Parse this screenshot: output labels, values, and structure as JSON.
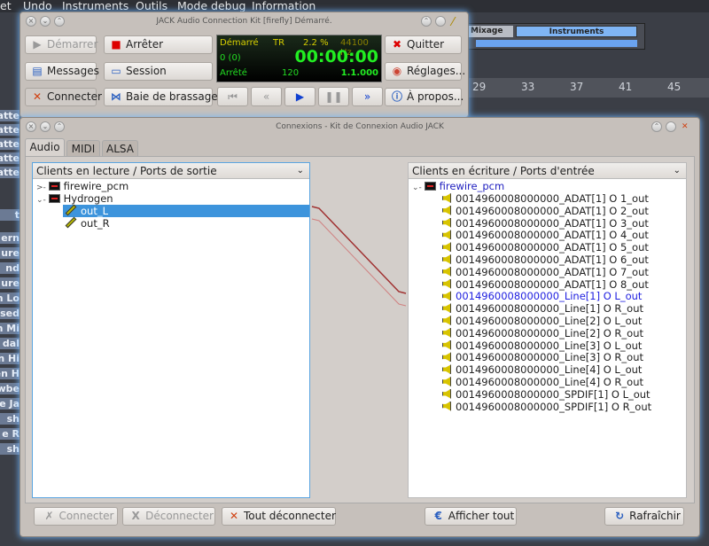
{
  "menubar": [
    "et",
    "Undo",
    "Instruments",
    "Outils",
    "Mode debug",
    "Information"
  ],
  "background": {
    "tabs": {
      "mixer": "Mixage",
      "instruments": "Instruments"
    },
    "ruler": [
      "29",
      "33",
      "37",
      "41",
      "45"
    ],
    "track_fragments": [
      "atte",
      "atte",
      "atte",
      "atte",
      "atte",
      "t",
      "ern",
      "ure",
      "nd",
      "ure",
      "n Lo",
      "sed",
      "n Mi",
      "dal",
      "n Hi",
      "en H",
      "wbe",
      "e Ja",
      "sh",
      "e R",
      "sh"
    ]
  },
  "jack": {
    "title": "JACK Audio Connection Kit [firefly] Démarré.",
    "buttons": {
      "start": "Démarrer",
      "stop": "Arrêter",
      "messages": "Messages",
      "session": "Session",
      "connect": "Connecter",
      "patchbay": "Baie de brassage",
      "quit": "Quitter",
      "setup": "Réglages...",
      "about": "À propos..."
    },
    "display": {
      "state": "Démarré",
      "tr": "TR",
      "dsp": "2.2 %",
      "rate": "44100 Hz",
      "xruns": "0 (0)",
      "time": "00:00:00",
      "transport": "Arrêté",
      "bpm": "120",
      "bbt": "1.1.000"
    },
    "colors": {
      "display_bg": "#000000",
      "display_green": "#22dd22",
      "display_yellow": "#d8d000"
    }
  },
  "connections": {
    "title": "Connexions - Kit de Connexion Audio JACK",
    "tabs": [
      "Audio",
      "MIDI",
      "ALSA"
    ],
    "active_tab": "Audio",
    "left": {
      "header": "Clients en lecture / Ports de sortie",
      "clients": [
        {
          "name": "firewire_pcm",
          "expanded": false,
          "ports": []
        },
        {
          "name": "Hydrogen",
          "expanded": true,
          "ports": [
            "out_L",
            "out_R"
          ]
        }
      ],
      "selected_port": "out_L"
    },
    "right": {
      "header": "Clients en écriture / Ports d'entrée",
      "client": "firewire_pcm",
      "ports": [
        "0014960008000000_ADAT[1] O 1_out",
        "0014960008000000_ADAT[1] O 2_out",
        "0014960008000000_ADAT[1] O 3_out",
        "0014960008000000_ADAT[1] O 4_out",
        "0014960008000000_ADAT[1] O 5_out",
        "0014960008000000_ADAT[1] O 6_out",
        "0014960008000000_ADAT[1] O 7_out",
        "0014960008000000_ADAT[1] O 8_out",
        "0014960008000000_Line[1] O L_out",
        "0014960008000000_Line[1] O R_out",
        "0014960008000000_Line[2] O L_out",
        "0014960008000000_Line[2] O R_out",
        "0014960008000000_Line[3] O L_out",
        "0014960008000000_Line[3] O R_out",
        "0014960008000000_Line[4] O L_out",
        "0014960008000000_Line[4] O R_out",
        "0014960008000000_SPDIF[1] O L_out",
        "0014960008000000_SPDIF[1] O R_out"
      ],
      "highlighted_port": "0014960008000000_Line[1] O L_out"
    },
    "buttons": {
      "connect": "Connecter",
      "disconnect": "Déconnecter",
      "disconnect_all": "Tout déconnecter",
      "expand_all": "Afficher tout",
      "refresh": "Rafraîchir"
    }
  }
}
